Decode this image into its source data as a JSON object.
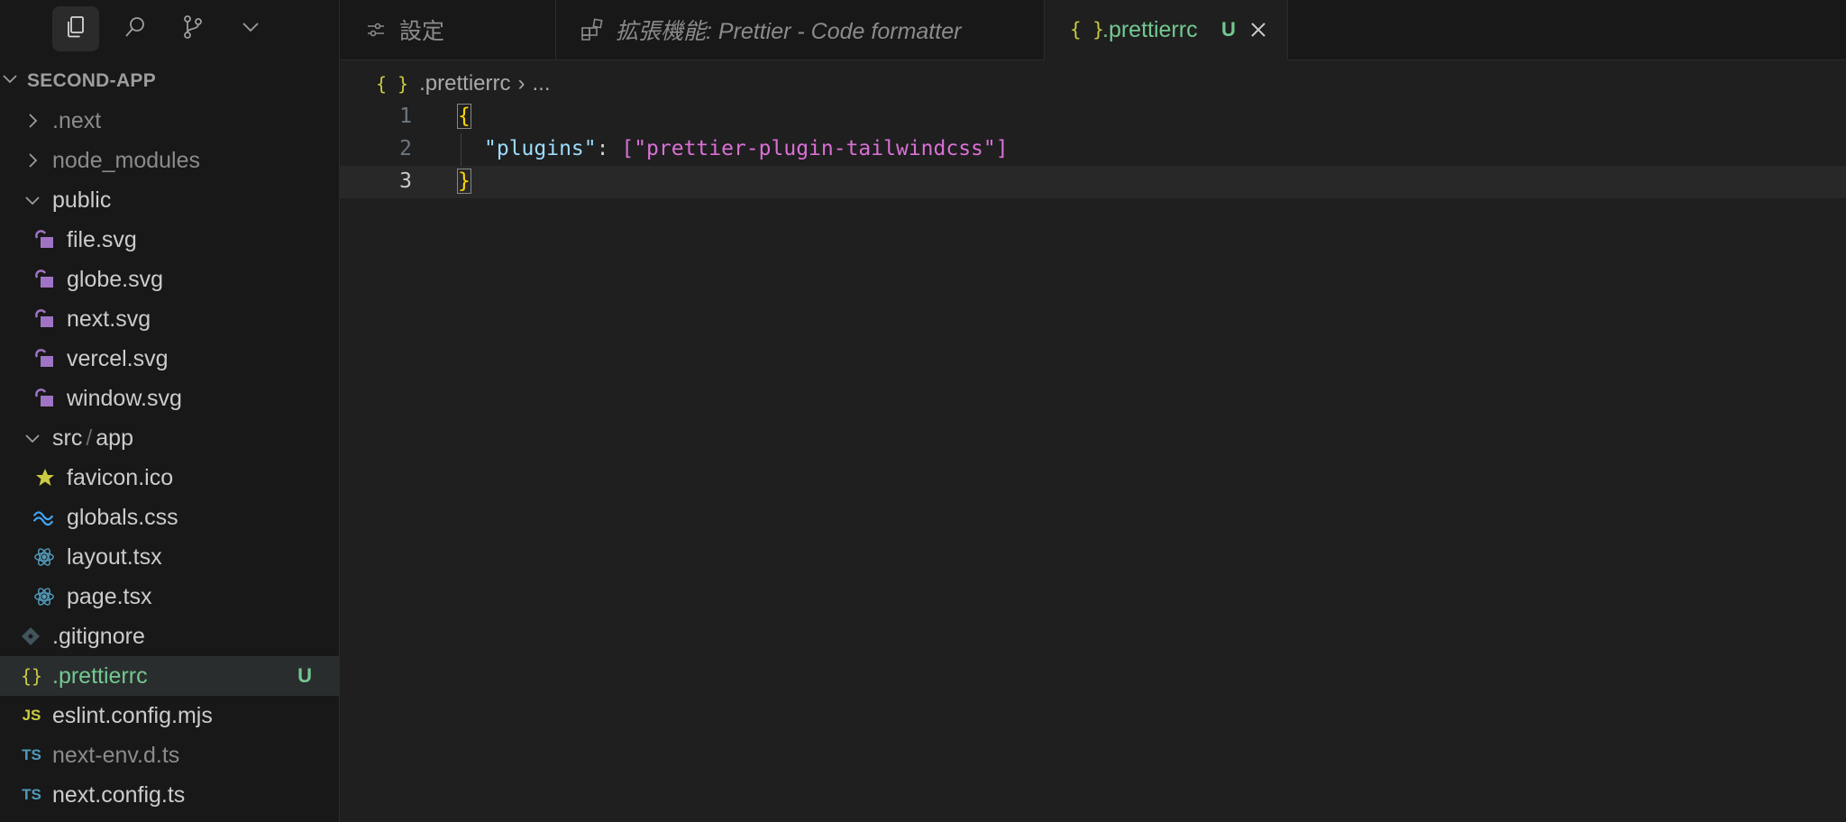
{
  "activity_bar": {
    "items": [
      {
        "icon": "files-icon",
        "active": true
      },
      {
        "icon": "search-icon",
        "active": false
      },
      {
        "icon": "source-control-icon",
        "active": false
      },
      {
        "icon": "chevron-down-icon",
        "active": false
      }
    ]
  },
  "explorer": {
    "root_label": "SECOND-APP",
    "items": [
      {
        "label": ".next",
        "type": "folder",
        "expanded": false
      },
      {
        "label": "node_modules",
        "type": "folder",
        "expanded": false
      },
      {
        "label": "public",
        "type": "folder",
        "expanded": true
      },
      {
        "label": "file.svg",
        "type": "svg"
      },
      {
        "label": "globe.svg",
        "type": "svg"
      },
      {
        "label": "next.svg",
        "type": "svg"
      },
      {
        "label": "vercel.svg",
        "type": "svg"
      },
      {
        "label": "window.svg",
        "type": "svg"
      },
      {
        "label_a": "src",
        "label_sep": "/",
        "label_b": "app",
        "type": "folder",
        "expanded": true
      },
      {
        "label": "favicon.ico",
        "type": "ico"
      },
      {
        "label": "globals.css",
        "type": "css"
      },
      {
        "label": "layout.tsx",
        "type": "react"
      },
      {
        "label": "page.tsx",
        "type": "react"
      },
      {
        "label": ".gitignore",
        "type": "git"
      },
      {
        "label": ".prettierrc",
        "type": "json",
        "badge": "U",
        "selected": true
      },
      {
        "label": "eslint.config.mjs",
        "type": "js",
        "icon_text": "JS"
      },
      {
        "label": "next-env.d.ts",
        "type": "ts",
        "icon_text": "TS"
      },
      {
        "label": "next.config.ts",
        "type": "ts",
        "icon_text": "TS"
      }
    ]
  },
  "tabs": [
    {
      "label": "設定",
      "icon": "settings-icon"
    },
    {
      "label": "拡張機能: Prettier - Code formatter",
      "icon": "extensions-icon"
    },
    {
      "label": ".prettierrc",
      "icon_text": "{ }",
      "badge": "U",
      "active": true
    }
  ],
  "breadcrumb": {
    "icon_text": "{ }",
    "file": ".prettierrc",
    "sep": "›",
    "rest": "..."
  },
  "editor": {
    "lines": [
      {
        "num": "1"
      },
      {
        "num": "2",
        "key": "\"plugins\"",
        "colon": ": ",
        "open": "[",
        "str": "\"prettier-plugin-tailwindcss\"",
        "close": "]"
      },
      {
        "num": "3"
      }
    ],
    "brace_open": "{",
    "brace_close": "}",
    "current_line": 3
  },
  "colors": {
    "accent_modified": "#73c991",
    "json_icon": "#cbcb41",
    "svg_icon": "#a074c4",
    "ts_icon": "#519aba",
    "js_icon": "#cbcb41",
    "react_icon": "#519aba",
    "css_icon": "#42a5f5",
    "ico_icon": "#cbcb41"
  }
}
